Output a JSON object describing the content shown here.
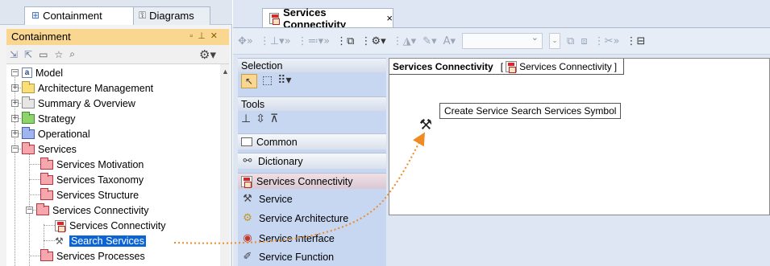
{
  "left_tabs": [
    {
      "label": "Containment",
      "icon": "containment-icon"
    },
    {
      "label": "Diagrams",
      "icon": "diagrams-icon"
    }
  ],
  "containment": {
    "title": "Containment",
    "tree": [
      {
        "label": "Model",
        "icon": "model-icon",
        "expander": "−"
      },
      {
        "label": "Architecture Management",
        "icon": "package-yellow",
        "expander": "+"
      },
      {
        "label": "Summary & Overview",
        "icon": "package-grey",
        "expander": "+"
      },
      {
        "label": "Strategy",
        "icon": "package-green",
        "expander": "+"
      },
      {
        "label": "Operational",
        "icon": "package-blue",
        "expander": "+"
      },
      {
        "label": "Services",
        "icon": "package-pink",
        "expander": "−"
      },
      {
        "label": "Services Motivation",
        "icon": "package-pink"
      },
      {
        "label": "Services Taxonomy",
        "icon": "package-pink"
      },
      {
        "label": "Services Structure",
        "icon": "package-pink"
      },
      {
        "label": "Services Connectivity",
        "icon": "package-pink",
        "expander": "−"
      },
      {
        "label": "Services Connectivity",
        "icon": "diagram-icon"
      },
      {
        "label": "Search Services",
        "icon": "service-icon",
        "selected": true
      },
      {
        "label": "Services Processes",
        "icon": "package-pink"
      }
    ]
  },
  "editor": {
    "tab_title": "Services Connectivity",
    "close_glyph": "×"
  },
  "palette": {
    "selection_header": "Selection",
    "tools_header": "Tools",
    "common_folder": "Common",
    "dictionary_item": "Dictionary",
    "connectivity_folder": "Services Connectivity",
    "items": [
      {
        "label": "Service",
        "icon": "service-icon"
      },
      {
        "label": "Service Architecture",
        "icon": "service-architecture-icon"
      },
      {
        "label": "Service Interface",
        "icon": "service-interface-icon"
      },
      {
        "label": "Service Function",
        "icon": "service-function-icon"
      }
    ]
  },
  "canvas": {
    "frame_title": "Services Connectivity",
    "frame_ref_open": "[",
    "frame_ref_label": "Services Connectivity",
    "frame_ref_close": "]",
    "tooltip": "Create Service Search Services Symbol"
  },
  "colors": {
    "selection_bg": "#0a64d6",
    "drag_arrow": "#f08a24",
    "panel_header": "#f9d791",
    "palette_bg": "#c7d7f2"
  }
}
